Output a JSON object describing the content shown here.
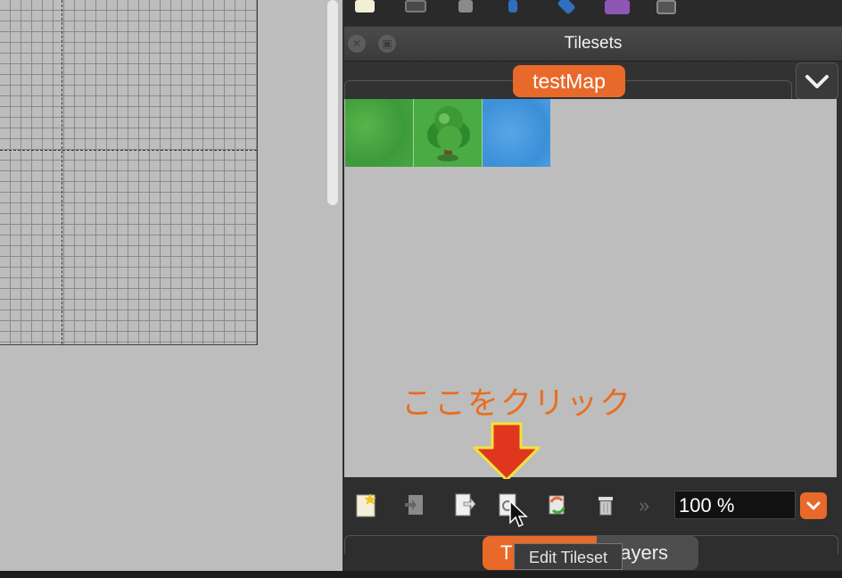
{
  "panel": {
    "title": "Tilesets"
  },
  "tabs": {
    "active": "testMap"
  },
  "annotation": {
    "text": "ここをクリック",
    "color": "#e86e20"
  },
  "zoom": {
    "value": "100 %"
  },
  "bottom_tabs": {
    "tilesets": "T",
    "layers": "Layers"
  },
  "tooltip": {
    "text": "Edit Tileset"
  },
  "tiles": [
    "grass",
    "tree",
    "water"
  ],
  "icons": {
    "top_toolbar": [
      "new-icon",
      "copy-icon",
      "delete-icon",
      "blue-tool-icon",
      "blue-tool-icon",
      "purple-layer-icon",
      "magnify-icon"
    ],
    "bottom_toolbar": [
      "new-tileset-icon",
      "import-tileset-icon",
      "export-tileset-icon",
      "edit-tileset-icon",
      "replace-tileset-icon",
      "remove-tileset-icon",
      "more-icon"
    ]
  },
  "colors": {
    "accent": "#e8692a",
    "arrow": "#e0361e",
    "arrow_outline": "#f3e23a"
  }
}
